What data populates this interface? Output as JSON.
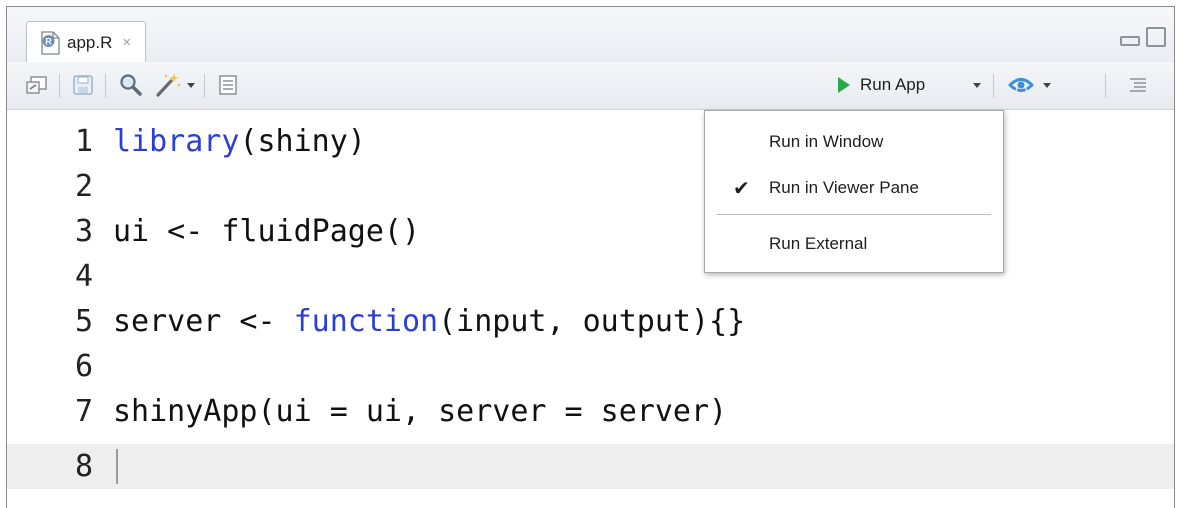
{
  "tab": {
    "label": "app.R",
    "close": "×"
  },
  "toolbar": {
    "run_app_label": "Run App"
  },
  "editor": {
    "lines": [
      {
        "num": "1",
        "text": "library(shiny)"
      },
      {
        "num": "2",
        "text": ""
      },
      {
        "num": "3",
        "text": "ui <- fluidPage()"
      },
      {
        "num": "4",
        "text": ""
      },
      {
        "num": "5",
        "text": "server <- function(input, output){}"
      },
      {
        "num": "6",
        "text": ""
      },
      {
        "num": "7",
        "text": "shinyApp(ui = ui, server = server)"
      },
      {
        "num": "8",
        "text": ""
      }
    ],
    "current_line": "8"
  },
  "run_menu": {
    "items": [
      {
        "label": "Run in Window",
        "checked": false
      },
      {
        "label": "Run in Viewer Pane",
        "checked": true
      },
      {
        "label": "Run External",
        "checked": false
      }
    ],
    "check_glyph": "✔"
  },
  "colors": {
    "keyword": "#2b3fd6",
    "run_play": "#29a84a",
    "current_line_bg": "#eeeeee"
  }
}
